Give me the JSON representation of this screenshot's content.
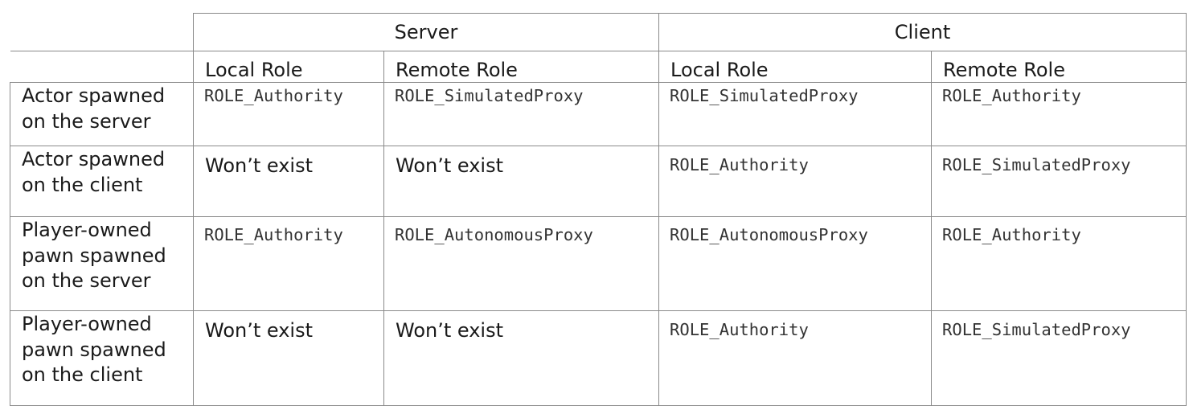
{
  "header": {
    "server": "Server",
    "client": "Client",
    "server_local": "Local Role",
    "server_remote": "Remote Role",
    "client_local": "Local Role",
    "client_remote": "Remote Role"
  },
  "rows": [
    {
      "label": "Actor spawned on the server",
      "label_lines": [
        "Actor spawned",
        "on the server"
      ],
      "server_local": "ROLE_Authority",
      "server_remote": "ROLE_SimulatedProxy",
      "client_local": "ROLE_SimulatedProxy",
      "client_remote": "ROLE_Authority"
    },
    {
      "label": "Actor spawned on the client",
      "label_lines": [
        "Actor spawned",
        "on the client"
      ],
      "server_local": "Won’t exist",
      "server_remote": "Won’t exist",
      "client_local": "ROLE_Authority",
      "client_remote": "ROLE_SimulatedProxy"
    },
    {
      "label": "Player-owned pawn spawned on the server",
      "label_lines": [
        "Player-owned",
        "pawn spawned",
        "on the server"
      ],
      "server_local": "ROLE_Authority",
      "server_remote": "ROLE_AutonomousProxy",
      "client_local": "ROLE_AutonomousProxy",
      "client_remote": "ROLE_Authority"
    },
    {
      "label": "Player-owned pawn spawned on the client",
      "label_lines": [
        "Player-owned",
        "pawn spawned",
        "on the client"
      ],
      "server_local": "Won’t exist",
      "server_remote": "Won’t exist",
      "client_local": "ROLE_Authority",
      "client_remote": "ROLE_SimulatedProxy"
    }
  ]
}
